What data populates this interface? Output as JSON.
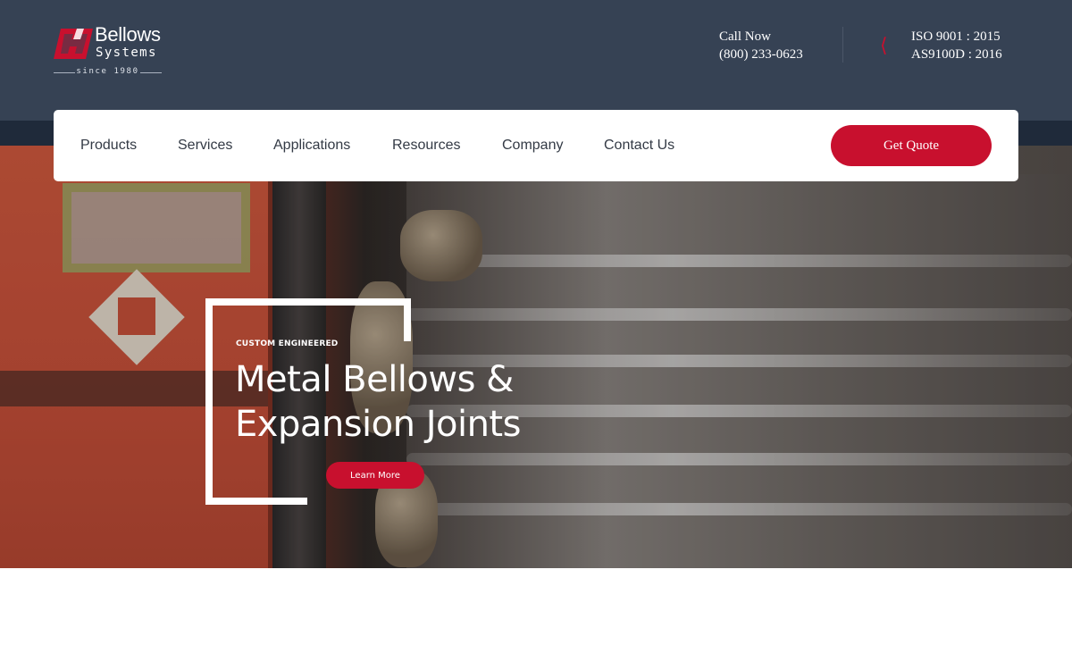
{
  "brand": {
    "name": "Bellows",
    "sub": "Systems",
    "since": "since 1980",
    "logo_color": "#c8102e"
  },
  "header": {
    "call_label": "Call Now",
    "phone": "(800) 233-0623",
    "cert_icon": "iso-badge-icon",
    "certs": [
      "ISO 9001 : 2015",
      "AS9100D : 2016"
    ],
    "background": "#364254"
  },
  "nav": {
    "items": [
      {
        "label": "Products"
      },
      {
        "label": "Services"
      },
      {
        "label": "Applications"
      },
      {
        "label": "Resources"
      },
      {
        "label": "Company"
      },
      {
        "label": "Contact Us"
      }
    ],
    "cta_label": "Get Quote",
    "accent": "#c8102e"
  },
  "hero": {
    "eyebrow": "CUSTOM ENGINEERED",
    "headline_line1": "Metal Bellows &",
    "headline_line2": "Expansion Joints",
    "button_label": "Learn More"
  }
}
